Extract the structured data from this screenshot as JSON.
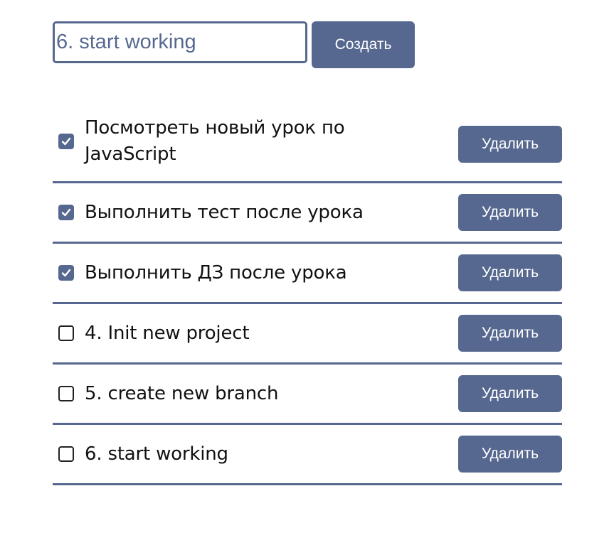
{
  "form": {
    "input_value": "6. start working",
    "create_label": "Создать"
  },
  "todos": [
    {
      "text": "Посмотреть новый урок по JavaScript",
      "done": true,
      "delete_label": "Удалить"
    },
    {
      "text": "Выполнить тест после урока",
      "done": true,
      "delete_label": "Удалить"
    },
    {
      "text": "Выполнить ДЗ после урока",
      "done": true,
      "delete_label": "Удалить"
    },
    {
      "text": "4. Init new project",
      "done": false,
      "delete_label": "Удалить"
    },
    {
      "text": "5. create new branch",
      "done": false,
      "delete_label": "Удалить"
    },
    {
      "text": "6. start working",
      "done": false,
      "delete_label": "Удалить"
    }
  ],
  "colors": {
    "accent": "#56688f"
  }
}
